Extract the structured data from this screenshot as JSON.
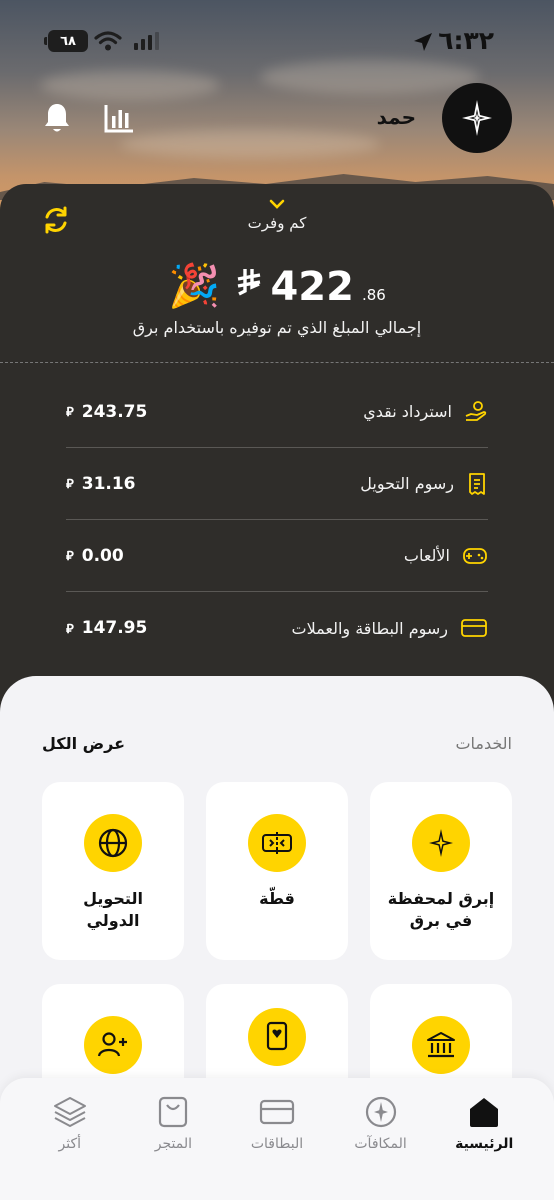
{
  "status_bar": {
    "time": "٦:٣٢",
    "battery": "٦٨"
  },
  "header": {
    "user_name": "حمد"
  },
  "savings": {
    "toggle_label": "كم وفرت",
    "total_integer": "422",
    "total_decimal": ".86",
    "currency_symbol": "ê",
    "caption": "إجمالي المبلغ الذي تم توفيره باستخدام برق",
    "items": [
      {
        "label": "استرداد نقدي",
        "amount": "243.75",
        "icon": "cashback-hand-icon"
      },
      {
        "label": "رسوم التحويل",
        "amount": "31.16",
        "icon": "receipt-icon"
      },
      {
        "label": "الألعاب",
        "amount": "0.00",
        "icon": "gamepad-icon"
      },
      {
        "label": "رسوم البطاقة والعملات",
        "amount": "147.95",
        "icon": "card-icon"
      }
    ]
  },
  "services": {
    "title": "الخدمات",
    "view_all": "عرض الكل",
    "tiles": [
      {
        "label": "إبرق لمحفظة في برق",
        "icon": "sparkle-icon"
      },
      {
        "label": "قطّة",
        "icon": "split-icon"
      },
      {
        "label": "التحويل الدولي",
        "icon": "globe-icon"
      },
      {
        "label": "",
        "icon": "bank-icon"
      },
      {
        "label": "",
        "icon": "playing-card-icon"
      },
      {
        "label": "",
        "icon": "add-user-icon"
      }
    ]
  },
  "nav": {
    "items": [
      {
        "label": "الرئيسية",
        "icon": "home-icon",
        "active": true
      },
      {
        "label": "المكافآت",
        "icon": "rewards-icon",
        "active": false
      },
      {
        "label": "البطاقات",
        "icon": "cards-icon",
        "active": false
      },
      {
        "label": "المتجر",
        "icon": "store-icon",
        "active": false
      },
      {
        "label": "أكثر",
        "icon": "layers-icon",
        "active": false
      }
    ]
  },
  "colors": {
    "accent": "#ffd400",
    "card_dark": "#2f2d2a",
    "background": "#f3f3f6"
  }
}
